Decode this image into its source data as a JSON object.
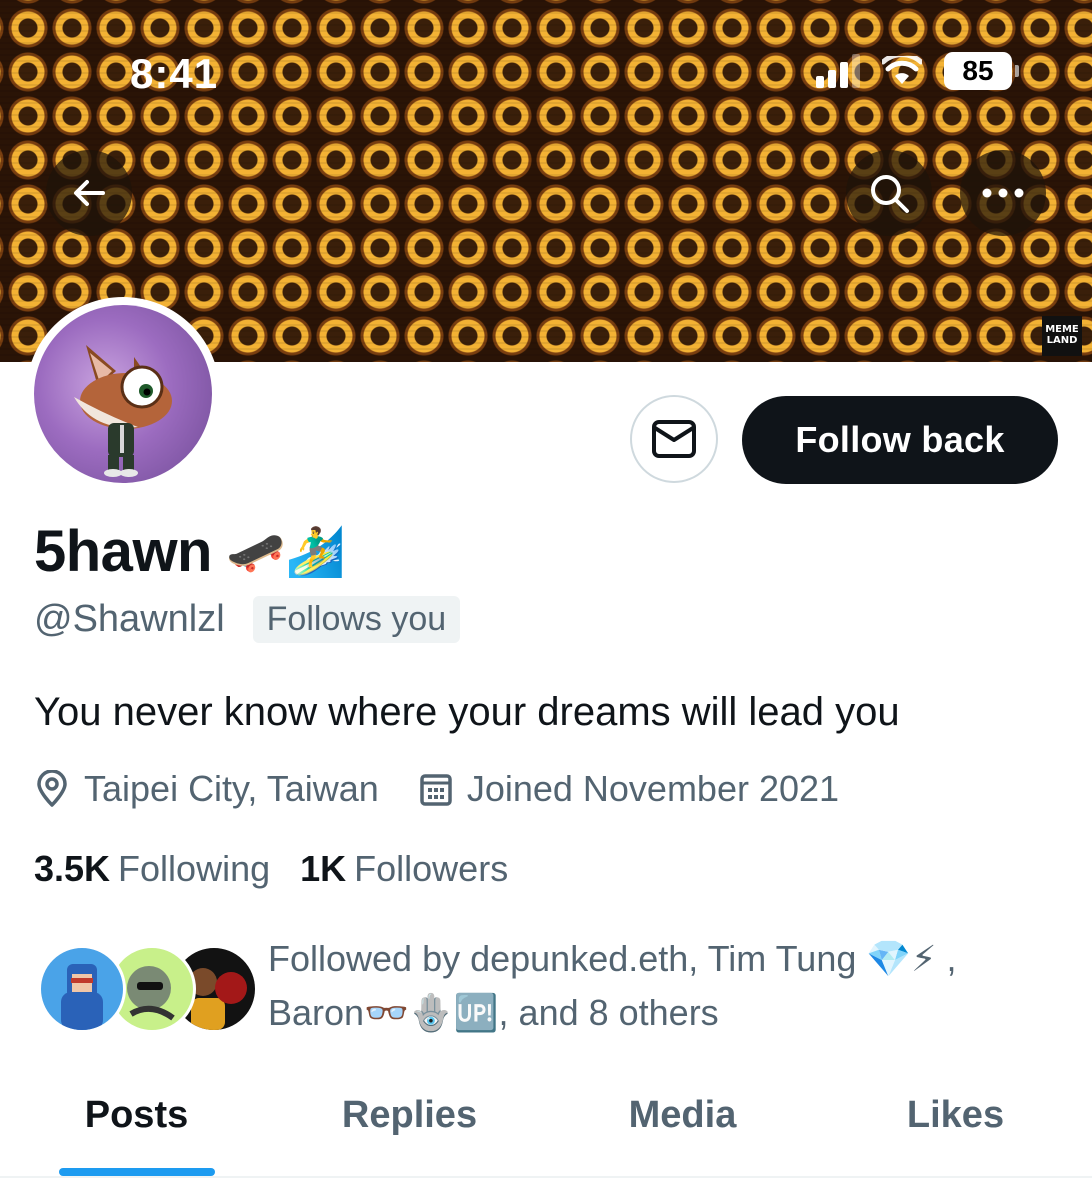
{
  "status_bar": {
    "time": "8:41",
    "battery": "85"
  },
  "banner": {
    "watermark_line1": "MEME",
    "watermark_line2": "LAND"
  },
  "profile": {
    "display_name": "5hawn",
    "name_emojis": "🛹🏄‍♂️",
    "handle": "@Shawnlzl",
    "follows_you": "Follows you",
    "bio": "You never know where your dreams will lead you",
    "location": "Taipei City, Taiwan",
    "joined": "Joined November 2021",
    "following_count": "3.5K",
    "following_label": "Following",
    "followers_count": "1K",
    "followers_label": "Followers"
  },
  "actions": {
    "follow_back": "Follow back"
  },
  "followed_by": {
    "line1": "Followed by depunked.eth, Tim Tung 💎⚡ ,",
    "line2": "Baron👓🪬🆙, and 8 others"
  },
  "tabs": [
    {
      "label": "Posts",
      "active": true
    },
    {
      "label": "Replies",
      "active": false
    },
    {
      "label": "Media",
      "active": false
    },
    {
      "label": "Likes",
      "active": false
    }
  ],
  "colors": {
    "accent": "#1d9bf0",
    "text_primary": "#0f1419",
    "text_secondary": "#536471",
    "button_dark": "#0f1419"
  },
  "icons": [
    "back-arrow-icon",
    "search-icon",
    "more-icon",
    "mail-icon",
    "location-icon",
    "calendar-icon"
  ]
}
